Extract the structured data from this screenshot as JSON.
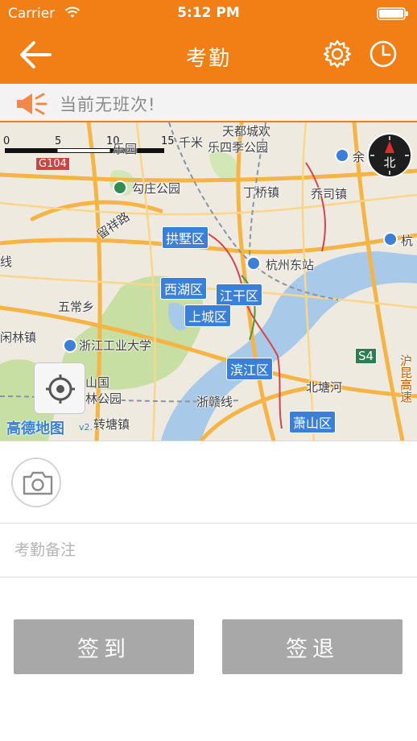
{
  "status_bar": {
    "carrier": "Carrier",
    "time": "5:12 PM",
    "wifi_icon": "wifi-icon",
    "battery_icon": "battery-full-icon"
  },
  "nav": {
    "title": "考勤",
    "back_icon": "arrow-left-icon",
    "settings_icon": "gear-icon",
    "history_icon": "clock-icon"
  },
  "notice": {
    "icon": "speaker-icon",
    "text": "当前无班次!"
  },
  "map": {
    "scale_labels": [
      "0",
      "5",
      "10",
      "15"
    ],
    "scale_unit": "千米",
    "highway_labels": [
      "G104",
      "S4"
    ],
    "places": [
      "天都城欢",
      "乐园",
      "乐四季公园",
      "勾庄公园",
      "丁桥镇",
      "乔司镇",
      "余",
      "杭",
      "留祥路",
      "杭州东站",
      "线",
      "五常乡",
      "闲林镇",
      "浙江工业大学",
      "山国",
      "林公园",
      "浙赣线",
      "北塘河",
      "转塘镇",
      "沪昆高速"
    ],
    "districts": [
      "拱墅区",
      "西湖区",
      "江干区",
      "上城区",
      "滨江区",
      "萧山区"
    ],
    "compass_label": "北",
    "logo": "高德地图",
    "logo_version": "v2.",
    "colors": {
      "district": "#3b7fd6",
      "road": "#f5b443",
      "water": "#a9c9e8",
      "green": "#c7dfa3"
    }
  },
  "form": {
    "camera_icon": "camera-icon",
    "remark_placeholder": "考勤备注",
    "remark_value": ""
  },
  "actions": {
    "sign_in": "签到",
    "sign_out": "签退"
  },
  "colors": {
    "accent": "#f27e16",
    "button_disabled": "#a8a8a8"
  }
}
